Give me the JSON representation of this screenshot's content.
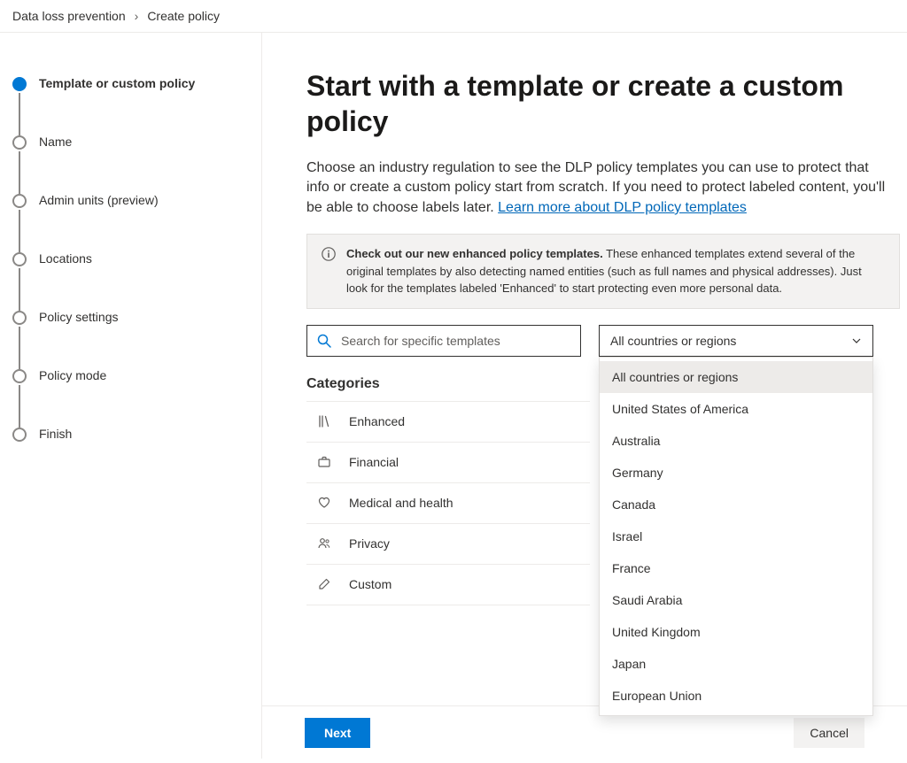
{
  "breadcrumb": {
    "parent": "Data loss prevention",
    "current": "Create policy"
  },
  "steps": [
    {
      "label": "Template or custom policy",
      "active": true
    },
    {
      "label": "Name",
      "active": false
    },
    {
      "label": "Admin units (preview)",
      "active": false
    },
    {
      "label": "Locations",
      "active": false
    },
    {
      "label": "Policy settings",
      "active": false
    },
    {
      "label": "Policy mode",
      "active": false
    },
    {
      "label": "Finish",
      "active": false
    }
  ],
  "heading": "Start with a template or create a custom policy",
  "intro_text": "Choose an industry regulation to see the DLP policy templates you can use to protect that info or create a custom policy start from scratch. If you need to protect labeled content, you'll be able to choose labels later. ",
  "intro_link": "Learn more about DLP policy templates",
  "banner": {
    "bold": "Check out our new enhanced policy templates.",
    "rest": " These enhanced templates extend several of the original templates by also detecting named entities (such as full names and physical addresses). Just look for the templates labeled 'Enhanced' to start protecting even more personal data."
  },
  "search": {
    "placeholder": "Search for specific templates"
  },
  "region_select": {
    "selected": "All countries or regions",
    "options": [
      "All countries or regions",
      "United States of America",
      "Australia",
      "Germany",
      "Canada",
      "Israel",
      "France",
      "Saudi Arabia",
      "United Kingdom",
      "Japan",
      "European Union"
    ]
  },
  "categories_heading": "Categories",
  "categories": [
    {
      "icon": "books",
      "label": "Enhanced"
    },
    {
      "icon": "briefcase",
      "label": "Financial"
    },
    {
      "icon": "heart",
      "label": "Medical and health"
    },
    {
      "icon": "people",
      "label": "Privacy"
    },
    {
      "icon": "edit",
      "label": "Custom"
    }
  ],
  "buttons": {
    "next": "Next",
    "cancel": "Cancel"
  }
}
